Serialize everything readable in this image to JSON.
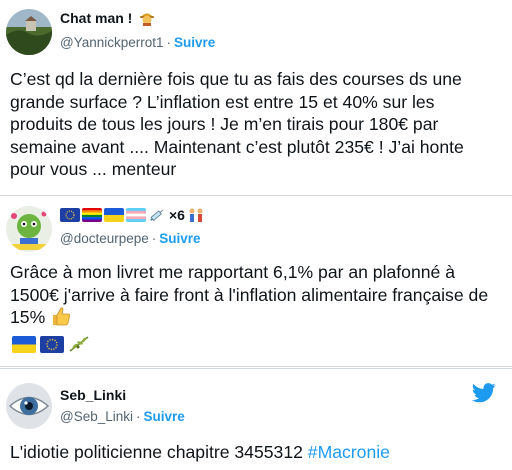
{
  "tweets": [
    {
      "display_name": "Chat man !",
      "handle": "@Yannickperrot1",
      "follow_label": "Suivre",
      "text": "C’est qd la dernière fois que tu as fais des courses ds une grande surface ? L’inflation est entre 15 et 40% sur les produits de tous les jours ! Je m’en tirais pour 180€ par semaine avant .... Maintenant c’est plutôt 235€ ! J’ai honte pour vous ... menteur"
    },
    {
      "display_name_suffix": "×6",
      "handle": "@docteurpepe",
      "follow_label": "Suivre",
      "text": "Grâce à mon livret me rapportant 6,1% par an plafonné à 1500€ j'arrive à faire front à l'inflation alimentaire française de 15%",
      "name_icons": [
        "eu-flag-icon",
        "rainbow-flag-icon",
        "ukraine-flag-icon",
        "trans-flag-icon",
        "syringe-icon"
      ],
      "text_icons": [
        "thumbs-up-icon",
        "ukraine-flag-icon",
        "eu-flag-icon",
        "olive-branch-icon"
      ]
    },
    {
      "display_name": "Seb_Linki",
      "handle": "@Seb_Linki",
      "follow_label": "Suivre",
      "text_prefix": "L'idiotie politicienne chapitre 3455312 ",
      "hashtag": "#Macronie"
    }
  ],
  "colors": {
    "link": "#1d9bf0",
    "text": "#0f1419",
    "secondary": "#536471"
  }
}
